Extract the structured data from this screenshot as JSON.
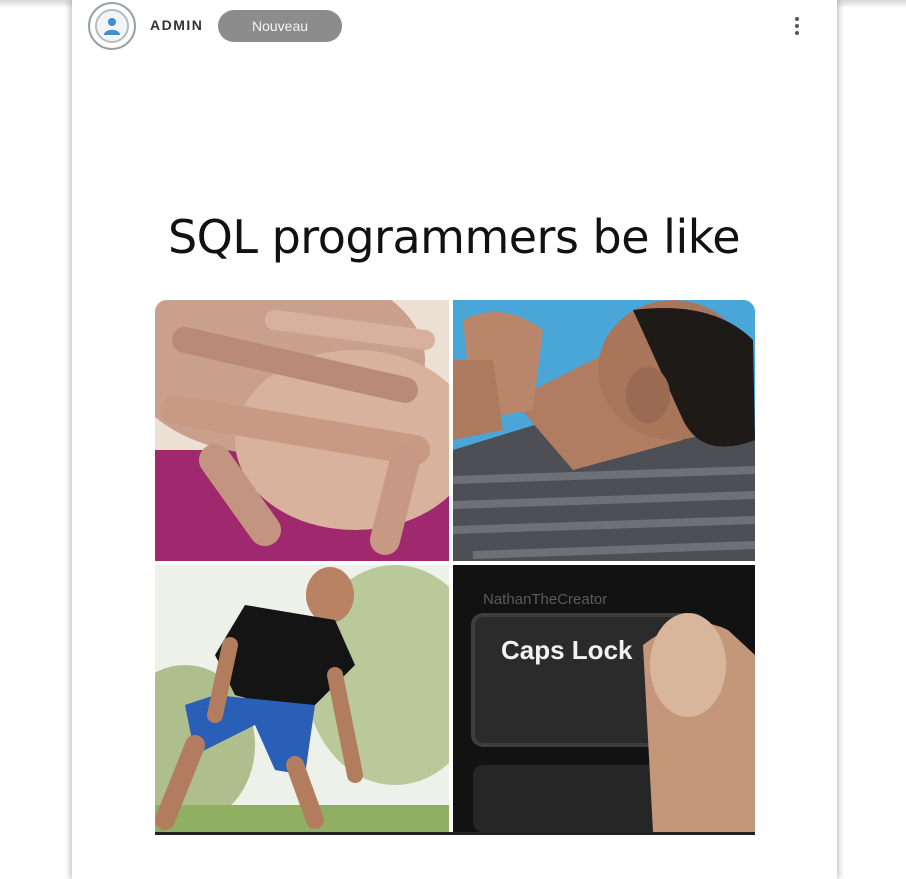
{
  "post": {
    "author": "ADMIN",
    "badge": "Nouveau",
    "menu_icon": "more-vertical-icon",
    "caption": "SQL programmers be like"
  },
  "meme": {
    "panels": [
      {
        "id": "hands-stretch",
        "description_icon": "hands-photo"
      },
      {
        "id": "neck-stretch",
        "description_icon": "man-neck-photo"
      },
      {
        "id": "leg-stretch",
        "description_icon": "man-lunge-photo"
      },
      {
        "id": "caps-lock-key",
        "description_icon": "keyboard-photo"
      }
    ],
    "watermark": "NathanTheCreator",
    "key_label": "Caps Lock"
  },
  "colors": {
    "badge_bg": "#8c8c8c",
    "text": "#111111"
  }
}
